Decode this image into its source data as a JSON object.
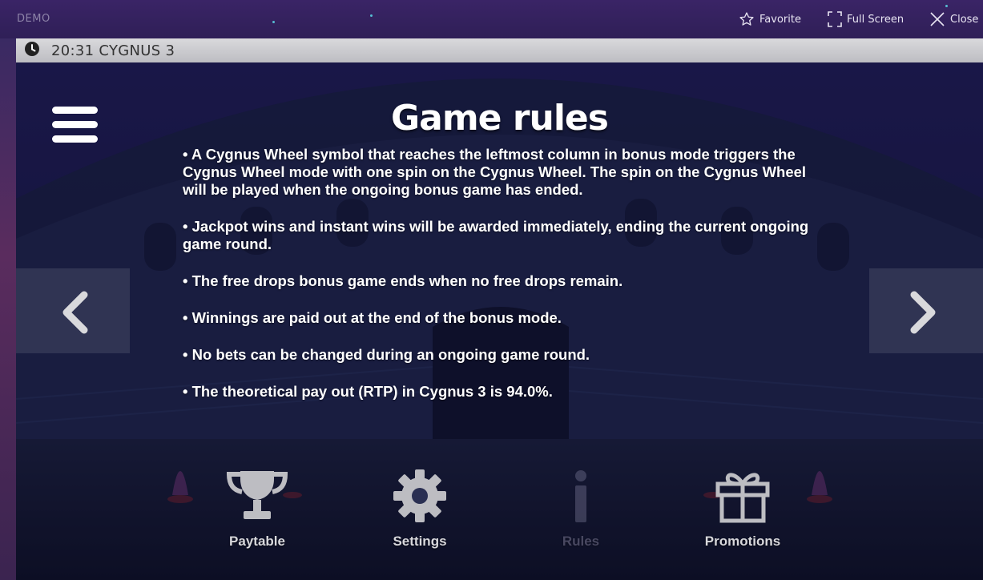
{
  "topbar": {
    "demo_label": "DEMO",
    "favorite_label": "Favorite",
    "fullscreen_label": "Full Screen",
    "close_label": "Close"
  },
  "game_header": {
    "time_title": "20:31 CYGNUS 3"
  },
  "rules": {
    "title": "Game rules",
    "paragraphs": [
      "• A Cygnus Wheel symbol that reaches the leftmost column in bonus mode triggers the Cygnus Wheel mode with one spin on the Cygnus Wheel. The spin on the Cygnus Wheel will be played when the ongoing bonus game has ended.",
      "• Jackpot wins and instant wins will be awarded immediately, ending the current ongoing game round.",
      "• The free drops bonus game ends when no free drops remain.",
      "• Winnings are paid out at the end of the bonus mode.",
      "• No bets can be changed during an ongoing game round.",
      "• The theoretical pay out (RTP) in Cygnus 3 is 94.0%."
    ]
  },
  "bottom_nav": {
    "paytable": "Paytable",
    "settings": "Settings",
    "rules": "Rules",
    "promotions": "Promotions"
  },
  "icons": {
    "favorite": "star-outline-icon",
    "fullscreen": "fullscreen-icon",
    "close": "close-icon",
    "clock": "clock-icon",
    "menu": "hamburger-menu-icon",
    "prev": "chevron-left-icon",
    "next": "chevron-right-icon",
    "paytable": "trophy-icon",
    "settings": "gear-icon",
    "rules": "info-icon",
    "promotions": "gift-icon"
  },
  "colors": {
    "topbar_bg": "#2f1f57",
    "header_bg": "#cfcfd3",
    "text_primary": "#ffffff",
    "nav_label": "#d8d8dc",
    "nav_disabled": "#6f6c86"
  }
}
